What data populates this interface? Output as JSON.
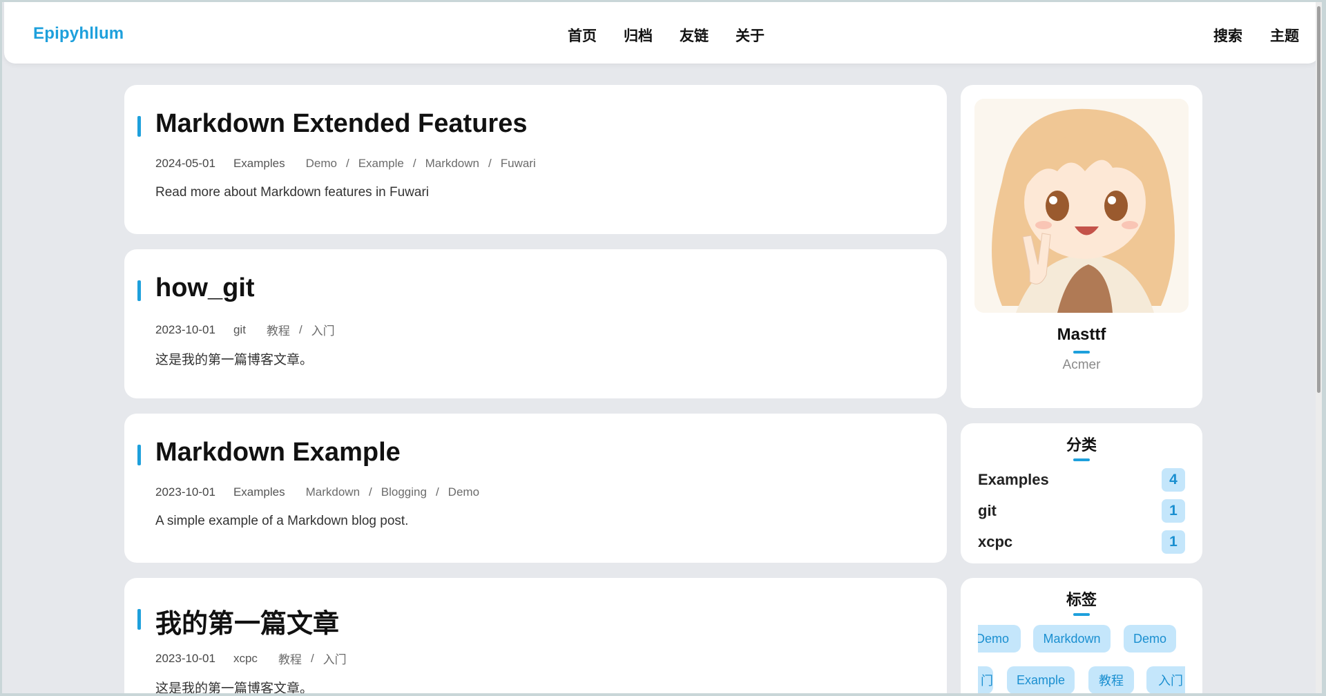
{
  "brand": "Epipyhllum",
  "nav": {
    "center": [
      "首页",
      "归档",
      "友链",
      "关于"
    ],
    "right": [
      "搜索",
      "主题"
    ]
  },
  "posts": [
    {
      "title": "Markdown Extended Features",
      "date": "2024-05-01",
      "category": "Examples",
      "tags": [
        "Demo",
        "Example",
        "Markdown",
        "Fuwari"
      ],
      "description": "Read more about Markdown features in Fuwari"
    },
    {
      "title": "how_git",
      "date": "2023-10-01",
      "category": "git",
      "tags": [
        "教程",
        "入门"
      ],
      "description": "这是我的第一篇博客文章。"
    },
    {
      "title": "Markdown Example",
      "date": "2023-10-01",
      "category": "Examples",
      "tags": [
        "Markdown",
        "Blogging",
        "Demo"
      ],
      "description": "A simple example of a Markdown blog post."
    },
    {
      "title": "我的第一篇文章",
      "date": "2023-10-01",
      "category": "xcpc",
      "tags": [
        "教程",
        "入门"
      ],
      "description": "这是我的第一篇博客文章。"
    }
  ],
  "profile": {
    "name": "Masttf",
    "bio": "Acmer"
  },
  "categories": {
    "title": "分类",
    "items": [
      {
        "name": "Examples",
        "count": "4"
      },
      {
        "name": "git",
        "count": "1"
      },
      {
        "name": "xcpc",
        "count": "1"
      }
    ]
  },
  "tags_widget": {
    "title": "标签",
    "items": [
      "Demo",
      "Markdown",
      "Demo",
      "门",
      "Example",
      "教程",
      "入门"
    ]
  },
  "colors": {
    "accent": "#1ea0dc",
    "chip_bg": "#c4e6fb",
    "page_bg": "#e6e8ec"
  }
}
